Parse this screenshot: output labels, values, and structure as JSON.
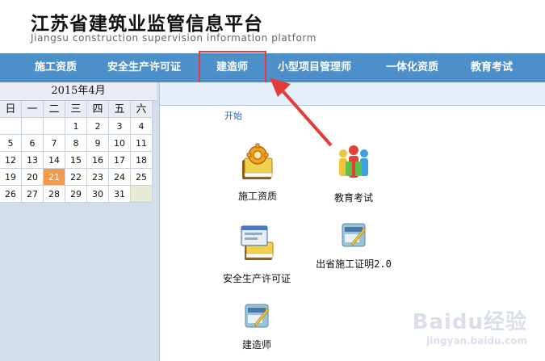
{
  "header": {
    "title_cn": "江苏省建筑业监管信息平台",
    "title_en": "Jiangsu construction supervision information platform"
  },
  "nav": {
    "items": [
      "施工资质",
      "安全生产许可证",
      "建造师",
      "小型项目管理师",
      "一体化资质",
      "教育考试"
    ],
    "highlighted": "建造师"
  },
  "calendar": {
    "title": "2015年4月",
    "weekdays": [
      "日",
      "一",
      "二",
      "三",
      "四",
      "五",
      "六"
    ],
    "rows": [
      [
        "",
        "",
        "",
        "1",
        "2",
        "3",
        "4"
      ],
      [
        "5",
        "6",
        "7",
        "8",
        "9",
        "10",
        "11"
      ],
      [
        "12",
        "13",
        "14",
        "15",
        "16",
        "17",
        "18"
      ],
      [
        "19",
        "20",
        "21",
        "22",
        "23",
        "24",
        "25"
      ],
      [
        "26",
        "27",
        "28",
        "29",
        "30",
        "31",
        ""
      ]
    ],
    "today": "21"
  },
  "main": {
    "start_label": "开始",
    "tiles": {
      "construction_qualification": "施工资质",
      "education_exam": "教育考试",
      "safety_license": "安全生产许可证",
      "out_of_province": "出省施工证明2.0",
      "builder": "建造师"
    }
  },
  "watermark": {
    "brand": "Baidu经验",
    "sub": "jingyan.baidu.com"
  },
  "colors": {
    "nav_bg": "#4d8fc8",
    "highlight": "#e53a3a",
    "today": "#f49a4a"
  }
}
